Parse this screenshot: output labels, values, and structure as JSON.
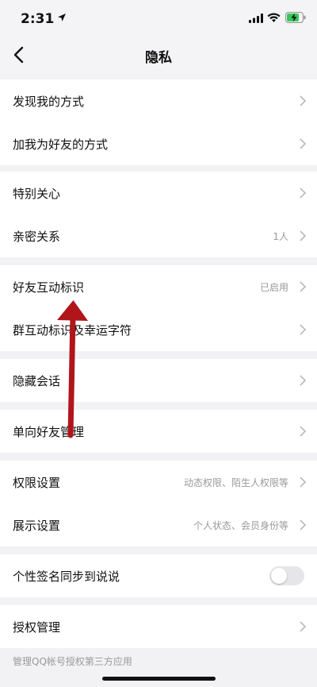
{
  "status": {
    "time": "2:31"
  },
  "nav": {
    "title": "隐私"
  },
  "groups": [
    {
      "items": [
        {
          "label": "发现我的方式",
          "value": ""
        },
        {
          "label": "加我为好友的方式",
          "value": ""
        }
      ]
    },
    {
      "items": [
        {
          "label": "特别关心",
          "value": ""
        },
        {
          "label": "亲密关系",
          "value": "1人"
        }
      ]
    },
    {
      "items": [
        {
          "label": "好友互动标识",
          "value": "已启用"
        },
        {
          "label": "群互动标识及幸运字符",
          "value": ""
        }
      ]
    },
    {
      "items": [
        {
          "label": "隐藏会话",
          "value": ""
        }
      ]
    },
    {
      "items": [
        {
          "label": "单向好友管理",
          "value": ""
        }
      ]
    },
    {
      "items": [
        {
          "label": "权限设置",
          "value": "动态权限、陌生人权限等"
        },
        {
          "label": "展示设置",
          "value": "个人状态、会员身份等"
        }
      ]
    },
    {
      "items": [
        {
          "label": "个性签名同步到说说",
          "toggle_on": false
        }
      ]
    },
    {
      "items": [
        {
          "label": "授权管理",
          "value": ""
        }
      ]
    }
  ],
  "footer": {
    "note": "管理QQ帐号授权第三方应用"
  },
  "colors": {
    "annotation_arrow": "#b0151b"
  }
}
